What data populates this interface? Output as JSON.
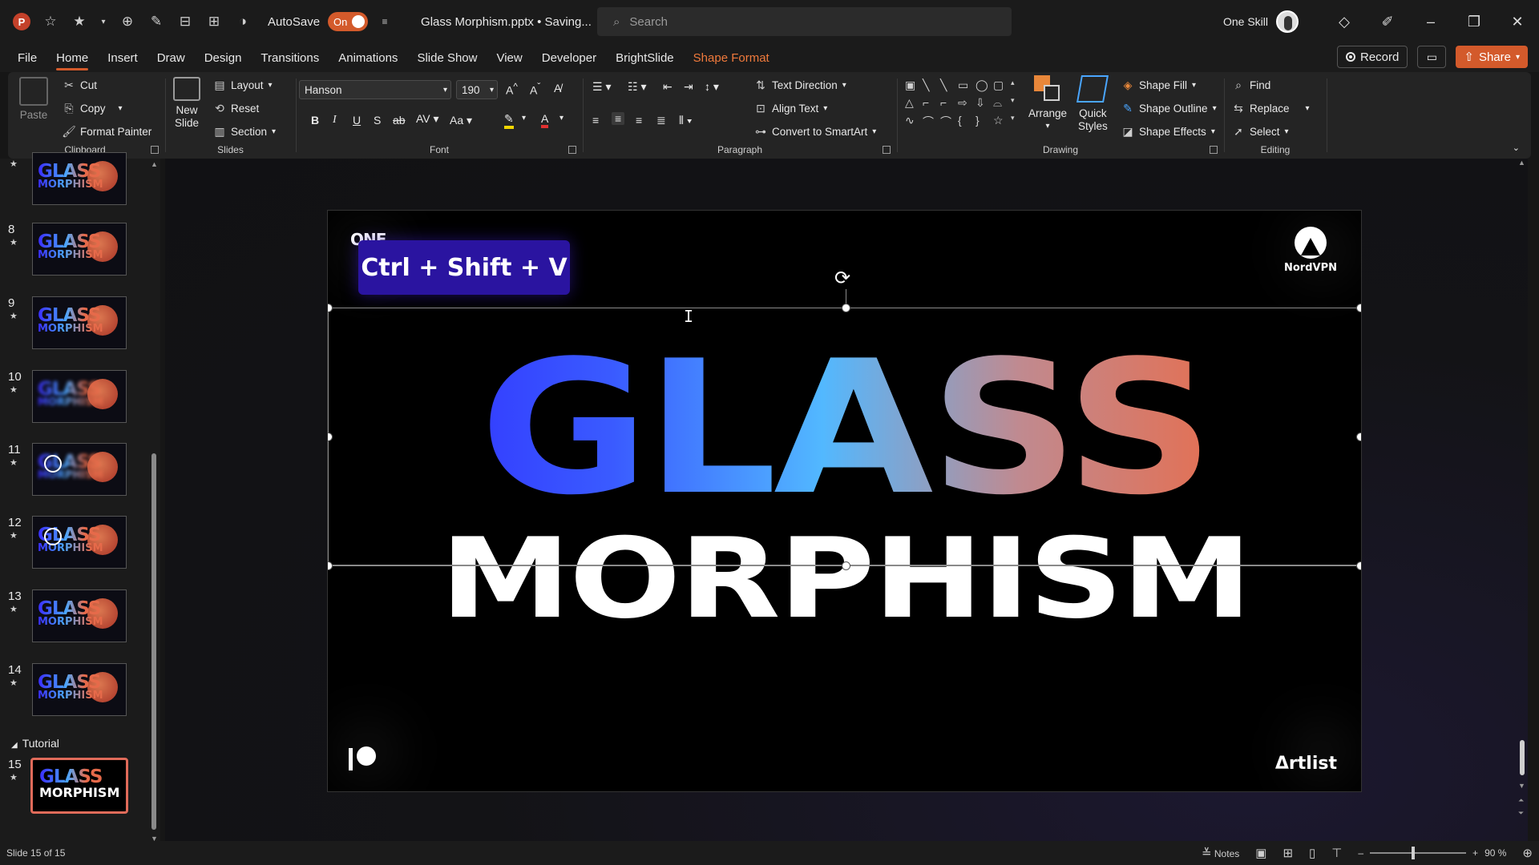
{
  "titlebar": {
    "autosave_label": "AutoSave",
    "autosave_state": "On",
    "doc_title": "Glass Morphism.pptx • Saving...",
    "search_placeholder": "Search",
    "user_name": "One Skill"
  },
  "menu": {
    "tabs": [
      "File",
      "Home",
      "Insert",
      "Draw",
      "Design",
      "Transitions",
      "Animations",
      "Slide Show",
      "View",
      "Developer",
      "BrightSlide",
      "Shape Format"
    ],
    "active_tab": "Home",
    "record_label": "Record",
    "share_label": "Share"
  },
  "ribbon": {
    "clipboard": {
      "label": "Clipboard",
      "paste": "Paste",
      "cut": "Cut",
      "copy": "Copy",
      "format_painter": "Format Painter"
    },
    "slides": {
      "label": "Slides",
      "new_slide_1": "New",
      "new_slide_2": "Slide",
      "layout": "Layout",
      "reset": "Reset",
      "section": "Section"
    },
    "font": {
      "label": "Font",
      "font_name": "Hanson",
      "font_size": "190"
    },
    "paragraph": {
      "label": "Paragraph",
      "text_direction": "Text Direction",
      "align_text": "Align Text",
      "convert_smartart": "Convert to SmartArt"
    },
    "drawing": {
      "label": "Drawing",
      "arrange": "Arrange",
      "quick_styles_1": "Quick",
      "quick_styles_2": "Styles",
      "shape_fill": "Shape Fill",
      "shape_outline": "Shape Outline",
      "shape_effects": "Shape Effects"
    },
    "editing": {
      "label": "Editing",
      "find": "Find",
      "replace": "Replace",
      "select": "Select"
    }
  },
  "thumbnails": [
    {
      "num": "",
      "variant": "normal"
    },
    {
      "num": "8",
      "variant": "normal"
    },
    {
      "num": "9",
      "variant": "normal"
    },
    {
      "num": "10",
      "variant": "blur"
    },
    {
      "num": "11",
      "variant": "circle"
    },
    {
      "num": "12",
      "variant": "circle"
    },
    {
      "num": "13",
      "variant": "normal"
    },
    {
      "num": "14",
      "variant": "normal"
    }
  ],
  "thumb_text": {
    "line1": "GLASS",
    "line2": "MORPHISM"
  },
  "section_name": "Tutorial",
  "selected_thumb": {
    "num": "15"
  },
  "slide": {
    "brand_top_left": "ONE",
    "shortcut_badge": "Ctrl + Shift + V",
    "nord_label": "NordVPN",
    "headline_1": "GLASS",
    "headline_2": "MORPHISM",
    "artlist_label": "Δrtlist"
  },
  "status": {
    "slide_counter": "Slide 15 of 15",
    "notes_label": "Notes",
    "zoom": "90 %",
    "zoom_level": 0.45
  },
  "colors": {
    "accent": "#d35a2b",
    "badge": "#2a14a0"
  }
}
